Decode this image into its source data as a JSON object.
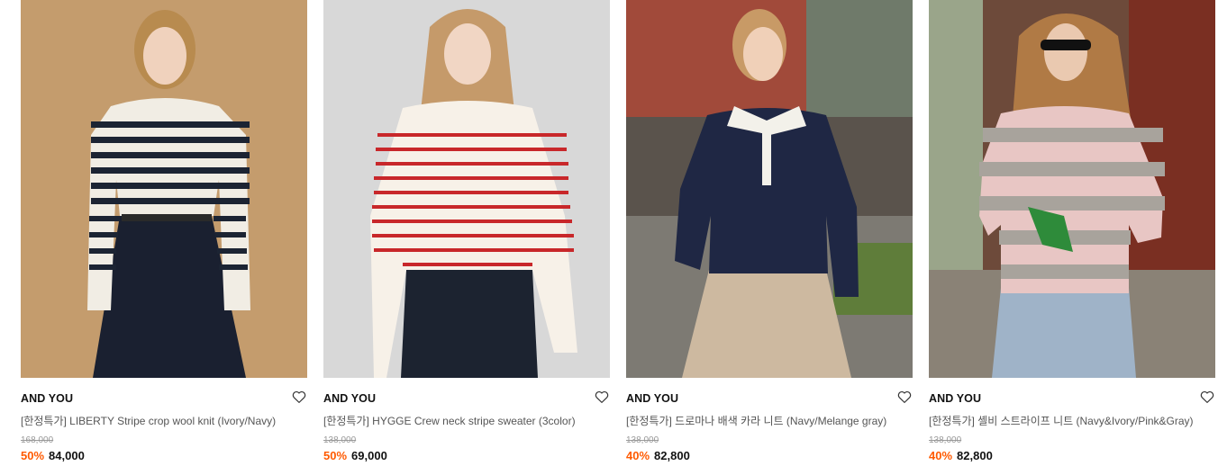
{
  "products": [
    {
      "brand": "AND YOU",
      "name": "[한정특가] LIBERTY Stripe crop wool knit (Ivory/Navy)",
      "original_price": "168,000",
      "discount": "50%",
      "sale_price": "84,000",
      "wishlist_icon": "heart-outline-icon",
      "photo_colors": {
        "background": "#c9a273",
        "top": "#f1ede4",
        "stripe": "#1c2433",
        "bottom": "#1a2030"
      }
    },
    {
      "brand": "AND YOU",
      "name": "[한정특가] HYGGE Crew neck stripe sweater (3color)",
      "original_price": "138,000",
      "discount": "50%",
      "sale_price": "69,000",
      "wishlist_icon": "heart-outline-icon",
      "photo_colors": {
        "background": "#d8d8d8",
        "top": "#f7f1e8",
        "stripe": "#c8272a",
        "bottom": "#1c2330"
      }
    },
    {
      "brand": "AND YOU",
      "name": "[한정특가] 드로마나 배색 카라 니트 (Navy/Melange gray)",
      "original_price": "138,000",
      "discount": "40%",
      "sale_price": "82,800",
      "wishlist_icon": "heart-outline-icon",
      "photo_colors": {
        "background": "#8a6a5a",
        "top": "#1f2744",
        "collar": "#f3f1ea",
        "bottom": "#cdb9a0"
      }
    },
    {
      "brand": "AND YOU",
      "name": "[한정특가] 셸비 스트라이프 니트 (Navy&Ivory/Pink&Gray)",
      "original_price": "138,000",
      "discount": "40%",
      "sale_price": "82,800",
      "wishlist_icon": "heart-outline-icon",
      "photo_colors": {
        "background": "#6d4a3a",
        "top": "#e8c6c4",
        "stripe": "#a8a39c",
        "bottom": "#9fb3c8"
      }
    }
  ],
  "accent_color": "#ff5a00"
}
